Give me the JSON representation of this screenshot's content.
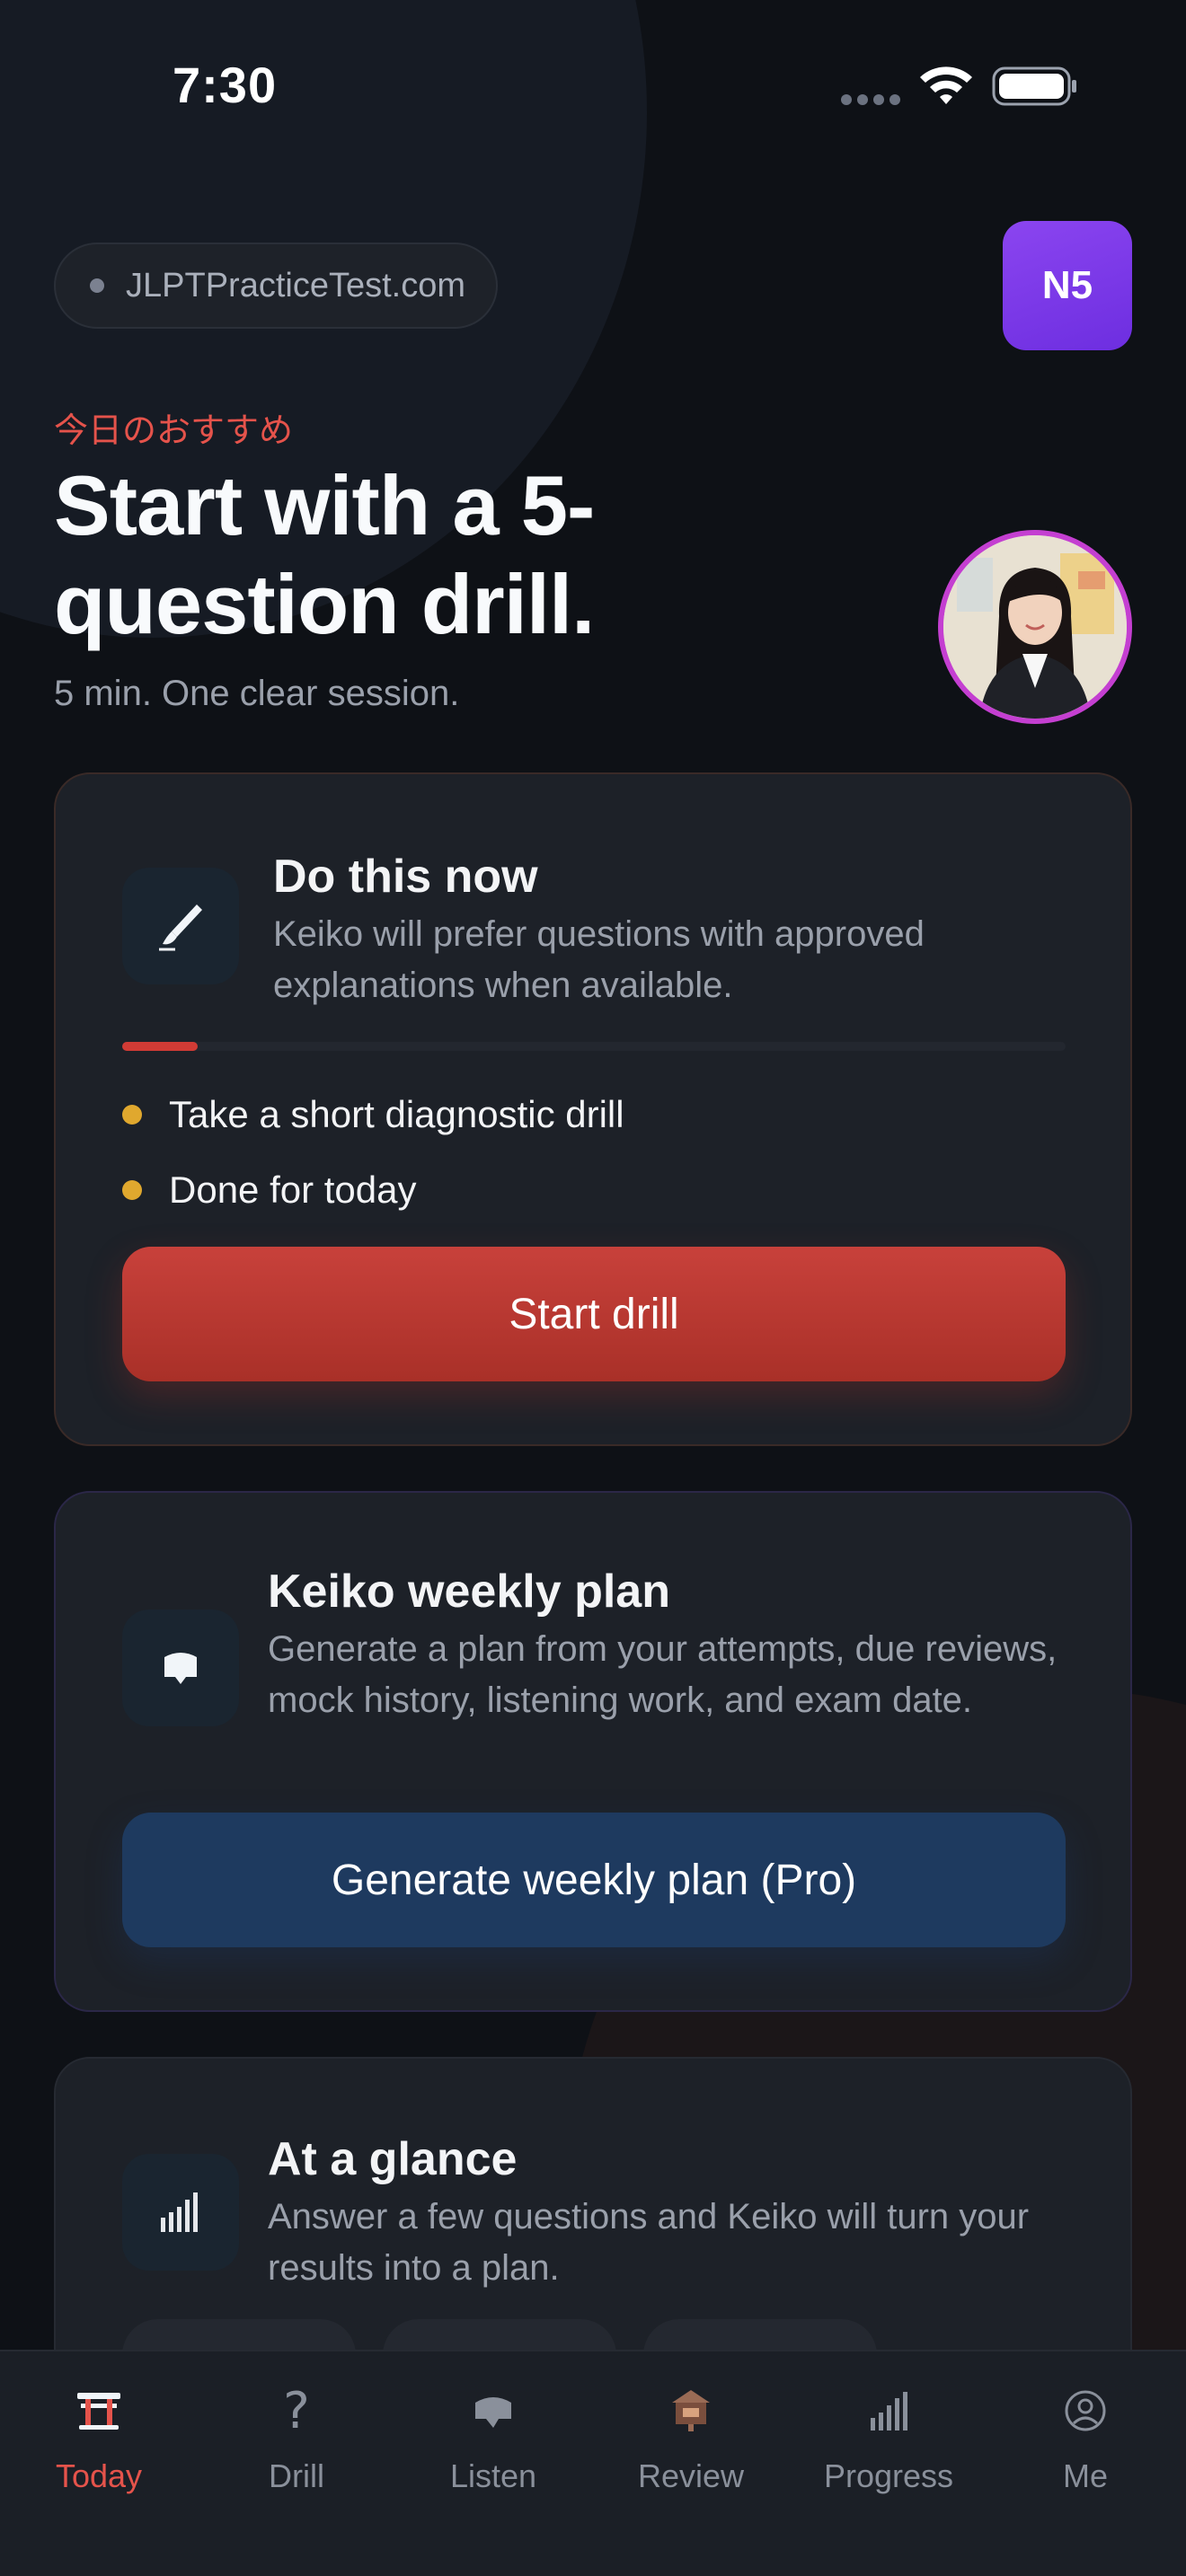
{
  "status_bar": {
    "time": "7:30"
  },
  "header": {
    "domain": "JLPTPracticeTest.com",
    "level": "N5",
    "recommendation_jp": "今日のおすすめ",
    "title": "Start with a 5-question drill.",
    "subtitle": "5 min. One clear session."
  },
  "do_now": {
    "title": "Do this now",
    "description": "Keiko will prefer questions with approved explanations when available.",
    "progress": 0.08,
    "items": [
      "Take a short diagnostic drill",
      "Done for today"
    ],
    "button": "Start drill"
  },
  "weekly_plan": {
    "title": "Keiko weekly plan",
    "description": "Generate a plan from your attempts, due reviews, mock history, listening work, and exam date.",
    "button": "Generate weekly plan (Pro)"
  },
  "glance": {
    "title": "At a glance",
    "description": "Answer a few questions and Keiko will turn your results into a plan."
  },
  "tabs": [
    {
      "label": "Today",
      "icon": "torii-gate-icon",
      "active": true
    },
    {
      "label": "Drill",
      "icon": "question-mark-icon",
      "active": false
    },
    {
      "label": "Listen",
      "icon": "speech-bubble-icon",
      "active": false
    },
    {
      "label": "Review",
      "icon": "ema-plaque-icon",
      "active": false
    },
    {
      "label": "Progress",
      "icon": "bar-chart-icon",
      "active": false
    },
    {
      "label": "Me",
      "icon": "user-circle-icon",
      "active": false
    }
  ],
  "colors": {
    "accent_red": "#e5534b",
    "level_purple": "#7c3aed",
    "bullet_yellow": "#e0a82e",
    "plan_button_blue": "#1e3a5f"
  }
}
